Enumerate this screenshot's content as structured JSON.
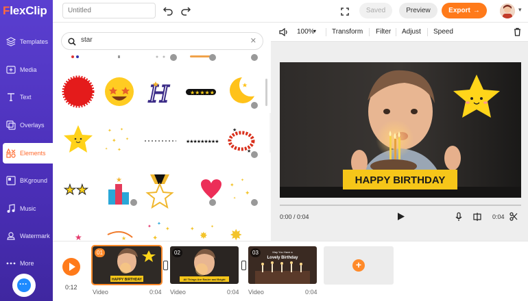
{
  "app": {
    "logo": "FlexClip"
  },
  "sidebar": {
    "items": [
      {
        "label": "Templates",
        "icon": "layers-icon"
      },
      {
        "label": "Media",
        "icon": "media-icon"
      },
      {
        "label": "Text",
        "icon": "text-icon"
      },
      {
        "label": "Overlays",
        "icon": "overlays-icon"
      },
      {
        "label": "Elements",
        "icon": "elements-icon",
        "active": true
      },
      {
        "label": "BKground",
        "icon": "background-icon"
      },
      {
        "label": "Music",
        "icon": "music-icon"
      },
      {
        "label": "Watermark",
        "icon": "watermark-icon"
      },
      {
        "label": "More",
        "icon": "more-icon"
      }
    ]
  },
  "topbar": {
    "title_placeholder": "Untitled",
    "saved_label": "Saved",
    "preview_label": "Preview",
    "export_label": "Export",
    "export_arrow": "→"
  },
  "panel": {
    "search_value": "star",
    "clear_glyph": "✕"
  },
  "editor": {
    "volume_label": "100%",
    "tools": [
      "Transform",
      "Filter",
      "Adjust",
      "Speed"
    ],
    "canvas_text": "HAPPY BIRTHDAY",
    "current_time": "0:00 / 0:04",
    "clip_duration": "0:04"
  },
  "timeline": {
    "total_time": "0:12",
    "clips": [
      {
        "num": "01",
        "label": "Video",
        "duration": "0:04",
        "caption": "HAPPY BIRTHDAY"
      },
      {
        "num": "02",
        "label": "Video",
        "duration": "0:04",
        "caption": "All Things Are Easier and Bright"
      },
      {
        "num": "03",
        "label": "Video",
        "duration": "0:04",
        "caption": "Lovely Birthday",
        "subcaption": "May You Have a"
      }
    ],
    "add_glyph": "+"
  },
  "colors": {
    "sidebar": "#4b2fb8",
    "accent": "#ff7a1a",
    "caption_yellow": "#f6c619",
    "star_yellow": "#ffd51a"
  }
}
